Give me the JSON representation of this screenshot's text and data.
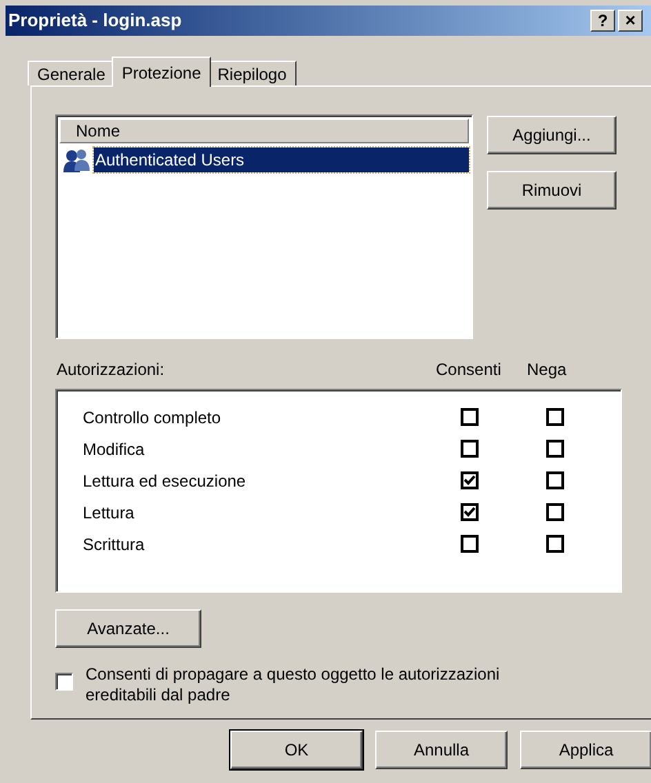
{
  "window": {
    "title": "Proprietà - login.asp",
    "help_button": "?",
    "close_button": "×"
  },
  "tabs": [
    {
      "label": "Generale",
      "selected": false
    },
    {
      "label": "Protezione",
      "selected": true
    },
    {
      "label": "Riepilogo",
      "selected": false
    }
  ],
  "users": {
    "column": "Nome",
    "items": [
      {
        "name": "Authenticated Users",
        "selected": true
      }
    ]
  },
  "user_buttons": [
    "Aggiungi...",
    "Rimuovi"
  ],
  "permissions": {
    "label": "Autorizzazioni:",
    "allow_header": "Consenti",
    "deny_header": "Nega",
    "rows": [
      {
        "name": "Controllo completo",
        "allow": false,
        "deny": false
      },
      {
        "name": "Modifica",
        "allow": false,
        "deny": false
      },
      {
        "name": "Lettura ed esecuzione",
        "allow": true,
        "deny": false
      },
      {
        "name": "Lettura",
        "allow": true,
        "deny": false
      },
      {
        "name": "Scrittura",
        "allow": false,
        "deny": false
      }
    ]
  },
  "advanced_button": "Avanzate...",
  "inherit": {
    "label": "Consenti di propagare a questo oggetto le autorizzazioni ereditabili dal padre",
    "checked": false
  },
  "dialog_buttons": [
    {
      "label": "OK",
      "default": true
    },
    {
      "label": "Annulla",
      "default": false
    },
    {
      "label": "Applica",
      "default": false
    }
  ]
}
